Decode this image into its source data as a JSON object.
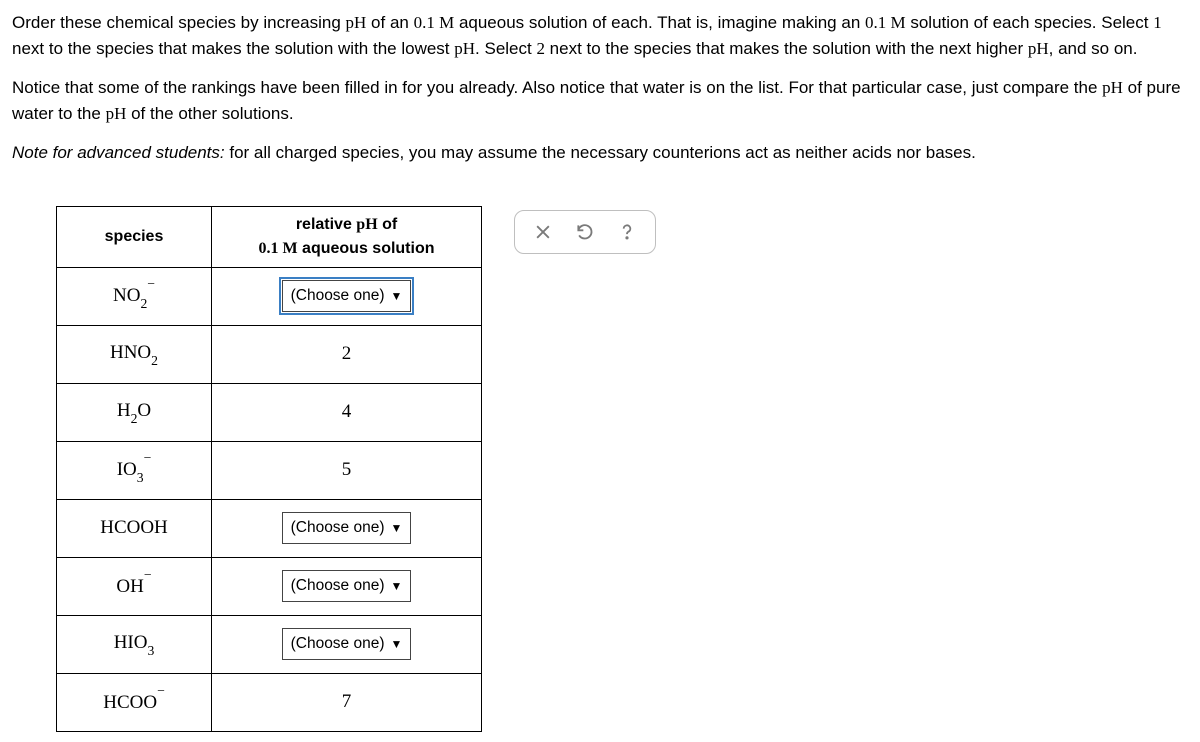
{
  "instructions": {
    "p1_a": "Order these chemical species by increasing ",
    "p1_ph": "pH",
    "p1_b": " of an ",
    "p1_conc": "0.1 M",
    "p1_c": " aqueous solution of each. That is, imagine making an ",
    "p1_conc2": "0.1 M",
    "p1_d": " solution of each species. Select ",
    "p1_one": "1",
    "p1_e": " next to the species that makes the solution with the lowest ",
    "p1_ph2": "pH",
    "p1_f": ". Select ",
    "p1_two": "2",
    "p1_g": " next to the species that makes the solution with the next higher ",
    "p1_ph3": "pH",
    "p1_h": ", and so on.",
    "p2_a": "Notice that some of the rankings have been filled in for you already. Also notice that water is on the list. For that particular case, just compare the ",
    "p2_ph": "pH",
    "p2_b": " of pure water to the ",
    "p2_ph2": "pH",
    "p2_c": " of the other solutions.",
    "p3_a": "Note for advanced students:",
    "p3_b": " for all charged species, you may assume the necessary counterions act as neither acids nor bases."
  },
  "table": {
    "header": {
      "species": "species",
      "ph_a": "relative ",
      "ph_b": "pH",
      "ph_c": " of",
      "ph_d": "0.1 M",
      "ph_e": " aqueous solution"
    },
    "choose_one": "(Choose one)",
    "rows": {
      "r2_val": "2",
      "r3_val": "4",
      "r4_val": "5",
      "r8_val": "7"
    }
  }
}
